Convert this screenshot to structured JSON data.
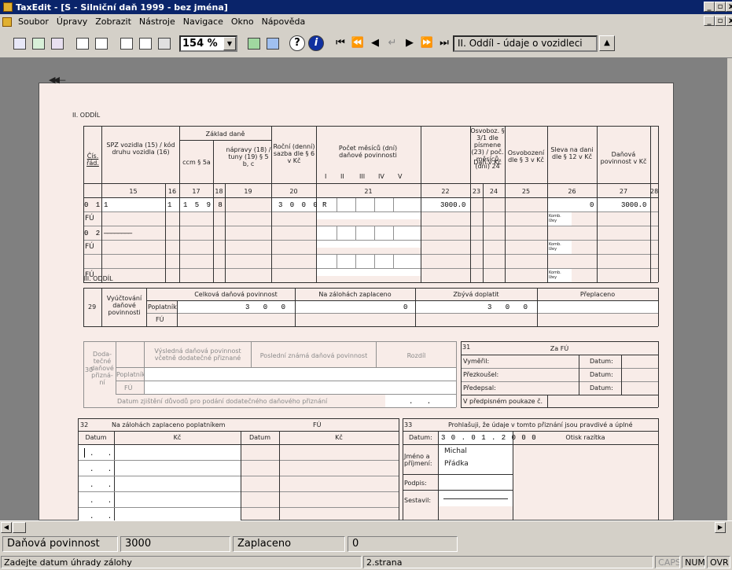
{
  "window": {
    "title": "TaxEdit - [S - Silniční daň 1999 - bez jména]",
    "min": "_",
    "max": "▫",
    "close": "x"
  },
  "menu": [
    "Soubor",
    "Úpravy",
    "Zobrazit",
    "Nástroje",
    "Navigace",
    "Okno",
    "Nápověda"
  ],
  "toolbar": {
    "zoom": "154 %",
    "section": "II. Oddíl - údaje o vozidleci",
    "help": "?",
    "info": "i"
  },
  "form": {
    "section2_title": "II. ODDÍL",
    "section3_title": "III. ODDÍL",
    "headers": {
      "cis_rad": "Čís. řád.",
      "spz": "SPZ vozidla (15) / kód druhu vozidla (16)",
      "zaklad_dane": "Základ daně",
      "ccm": "ccm § 5a",
      "napravy": "nápravy (18) / tuny (19) § 5 b, c",
      "rocni_sazba": "Roční (denní) sazba dle § 6 v Kč",
      "pocet_mesicu": "Počet měsíců (dní) daňové povinnosti",
      "quarters": [
        "I",
        "II",
        "III",
        "IV",
        "V"
      ],
      "dan": "Daň v Kč",
      "osvoboz": "Osvoboz. § 3/1 dle písmene (23) / poč. měsíců (dní) 24",
      "osvobozeni": "Osvobození dle § 3 v Kč",
      "sleva": "Sleva na dani dle § 12 v Kč",
      "povinnost": "Daňová povinnost v Kč",
      "colnums": [
        "15",
        "16",
        "17",
        "18",
        "19",
        "20",
        "21",
        "22",
        "23",
        "24",
        "25",
        "26",
        "27",
        "28"
      ]
    },
    "rows": [
      {
        "label": "0 1",
        "spz": "1",
        "kod": "1",
        "ccm": "1 5 9 8",
        "sazba": "3 0 0 0",
        "mesice": "R",
        "dan": "3000.0",
        "sleva": "0",
        "povinnost": "3000.0"
      },
      {
        "label": "FÚ"
      },
      {
        "label": "0 2",
        "spz": "————————"
      },
      {
        "label": "FÚ",
        "komb": "Komb. lžey"
      },
      {
        "label": ""
      },
      {
        "label": "FÚ",
        "komb": "Komb. lžey"
      }
    ],
    "komb_label": "Komb. lžey",
    "s3": {
      "row": "29",
      "vyuct": "Vyúčtování daňové povinnosti",
      "poplatnik": "Poplatník",
      "fu": "FÚ",
      "celkova": "Celková daňová povinnost",
      "zalohy": "Na zálohách zaplaceno",
      "zbyva": "Zbývá doplatit",
      "preplaceno": "Přeplaceno",
      "celkova_val": "3 0 0 0",
      "zalohy_val": "0",
      "zbyva_val": "3 0 0 0"
    },
    "s30": {
      "row": "30",
      "dodatecne": "Doda- tečné daňové přizná- ní",
      "poplatnik": "Poplatník",
      "fu": "FÚ",
      "vysledna": "Výsledná daňová povinnost včetně dodatečné přiznané",
      "posledni": "Poslední známá daňová povinnost",
      "rozdil": "Rozdíl",
      "datum_zjisteni": "Datum zjištění důvodů pro podání dodatečného daňového přiznání",
      "date_mask": ". ."
    },
    "s31": {
      "row": "31",
      "za_fu": "Za FÚ",
      "vymeril": "Vyměřil:",
      "prezkousel": "Přezkoušel:",
      "predepsal": "Předepsal:",
      "poukaze": "V předpisném poukaze č.",
      "datum": "Datum:"
    },
    "s32": {
      "row": "32",
      "title": "Na zálohách zaplaceno poplatníkem",
      "fu": "FÚ",
      "datum": "Datum",
      "kc": "Kč",
      "date_mask": ". ."
    },
    "s33": {
      "row": "33",
      "prohlasuji": "Prohlašuji, že údaje v tomto přiznání jsou pravdivé a úplné",
      "datum": "Datum:",
      "datum_val": "3 0 . 0 1 . 2 0 0 0",
      "otisk": "Otisk razítka",
      "jmeno": "Jméno a příjmení:",
      "jmeno_val1": "Michal",
      "jmeno_val2": "Přádka",
      "podpis": "Podpis:",
      "sestavil": "Sestavil:"
    }
  },
  "infobar": {
    "dp_label": "Daňová povinnost",
    "dp_value": "3000",
    "zap_label": "Zaplaceno",
    "zap_value": "0"
  },
  "status": {
    "hint": "Zadejte datum úhrady zálohy",
    "page": "2.strana",
    "caps": "CAPS",
    "num": "NUM",
    "ovr": "OVR"
  }
}
